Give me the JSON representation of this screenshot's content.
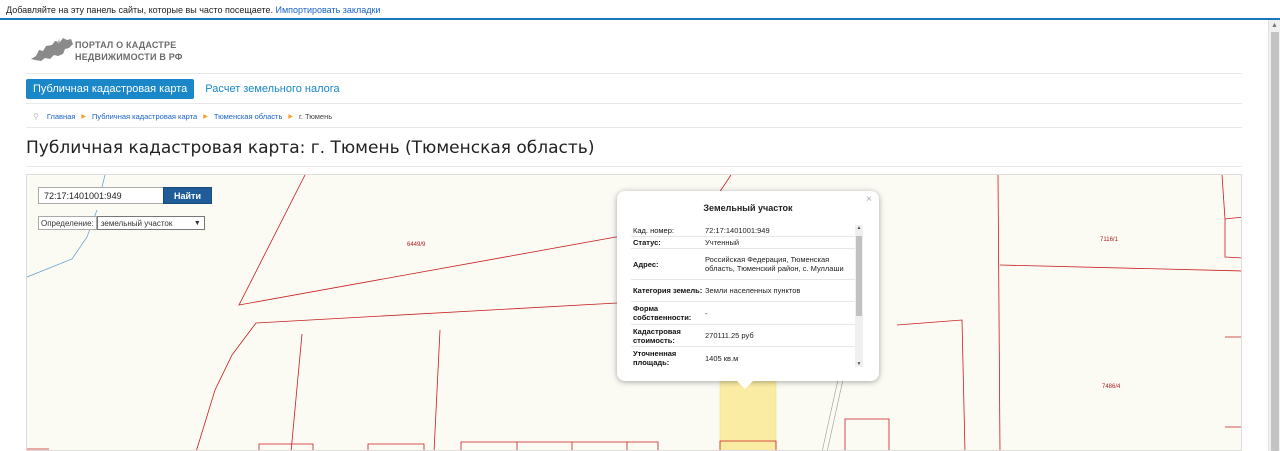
{
  "bookmarks_bar": {
    "text": "Добавляйте на эту панель сайты, которые вы часто посещаете.",
    "link": "Импортировать закладки"
  },
  "logo": {
    "line1": "ПОРТАЛ О КАДАСТРЕ",
    "line2": "НЕДВИЖИМОСТИ В РФ",
    "icon": "russia-map-icon"
  },
  "nav": {
    "tabs": [
      {
        "label": "Публичная кадастровая карта",
        "active": true
      },
      {
        "label": "Расчет земельного налога",
        "active": false
      }
    ]
  },
  "breadcrumb": {
    "items": [
      "Главная",
      "Публичная кадастровая карта",
      "Тюменская область"
    ],
    "current": "г. Тюмень"
  },
  "page_title": "Публичная кадастровая карта: г. Тюмень (Тюменская область)",
  "map": {
    "search_value": "72:17:1401001:949",
    "search_button": "Найти",
    "definition_label": "Определение:",
    "definition_selected": "земельный участок",
    "parcel_labels": {
      "a": "6449/9",
      "b": "7116/1",
      "c": "7486/4"
    },
    "colors": {
      "boundary": "#c81e1e",
      "highlight": "#fbeca4",
      "water": "#5b9bd5"
    }
  },
  "popup": {
    "title": "Земельный участок",
    "close": "×",
    "rows": [
      {
        "key": "Кад. номер:",
        "value": "72:17:1401001:949"
      },
      {
        "key": "Статус:",
        "value": "Учтенный"
      },
      {
        "key": "Адрес:",
        "value": "Российская Федерация, Тюменская область, Тюменский район, с. Муллаши"
      },
      {
        "key": "Категория земель:",
        "value": "Земли населенных пунктов"
      },
      {
        "key": "Форма собственности:",
        "value": "-"
      },
      {
        "key": "Кадастровая стоимость:",
        "value": "270111.25 руб"
      },
      {
        "key": "Уточненная площадь:",
        "value": "1405 кв.м"
      }
    ]
  }
}
